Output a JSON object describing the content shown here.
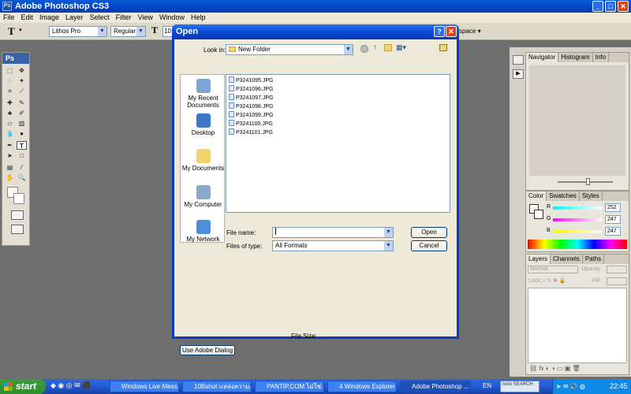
{
  "app": {
    "title": "Adobe Photoshop CS3",
    "ps_badge": "Ps"
  },
  "menu": [
    "File",
    "Edit",
    "Image",
    "Layer",
    "Select",
    "Filter",
    "View",
    "Window",
    "Help"
  ],
  "options_bar": {
    "font_family": "Lithos Pro",
    "font_style": "Regular",
    "font_size": "10",
    "workspace_label": "space"
  },
  "dialog": {
    "title": "Open",
    "look_in_label": "Look in:",
    "look_in_value": "New Folder",
    "places": [
      "My Recent Documents",
      "Desktop",
      "My Documents",
      "My Computer",
      "My Network"
    ],
    "files": [
      "P3241095.JPG",
      "P3241096.JPG",
      "P3241097.JPG",
      "P3241098.JPG",
      "P3241099.JPG",
      "P3241100.JPG",
      "P3241101.JPG"
    ],
    "file_name_label": "File name:",
    "file_name_value": "",
    "files_of_type_label": "Files of type:",
    "files_of_type_value": "All Formats",
    "open_button": "Open",
    "cancel_button": "Cancel",
    "file_size_label": "File Size:",
    "adobe_dialog_button": "Use Adobe Dialog"
  },
  "panels": {
    "navigator_tabs": [
      "Navigator",
      "Histogram",
      "Info"
    ],
    "color_tabs": [
      "Color",
      "Swatches",
      "Styles"
    ],
    "color_channels": [
      {
        "label": "R",
        "value": "252"
      },
      {
        "label": "G",
        "value": "247"
      },
      {
        "label": "B",
        "value": "247"
      }
    ],
    "layers_tabs": [
      "Layers",
      "Channels",
      "Paths"
    ],
    "layers_blend": "Normal",
    "layers_opacity_label": "Opacity:",
    "layers_lock_label": "Lock:",
    "layers_fill_label": "Fill:"
  },
  "taskbar": {
    "start_label": "start",
    "tasks": [
      "Windows Live Mess...",
      "10Bshot แหล่งความ...",
      "PANTIP.COM ไม่ใช่...",
      "4 Windows Explorer",
      "Adobe Photoshop ..."
    ],
    "lang": "EN",
    "clock": "22:45",
    "nero_label": "nero SEARCH"
  }
}
